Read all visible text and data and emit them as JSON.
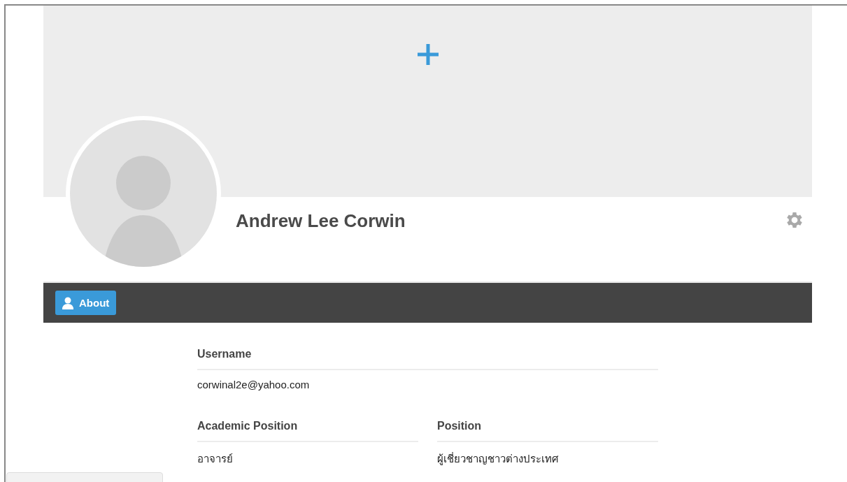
{
  "profile": {
    "name": "Andrew Lee Corwin"
  },
  "nav": {
    "tabs": [
      {
        "label": "About",
        "selected": true
      }
    ]
  },
  "about": {
    "username": {
      "label": "Username",
      "value": "corwinal2e@yahoo.com"
    },
    "fields": [
      {
        "label": "Academic Position",
        "value": "อาจารย์"
      },
      {
        "label": "Position",
        "value": "ผู้เชี่ยวชาญชาวต่างประเทศ"
      }
    ]
  }
}
